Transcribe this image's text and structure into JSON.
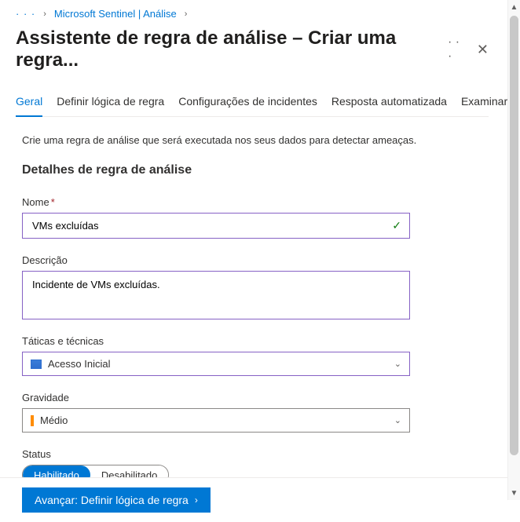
{
  "breadcrumb": {
    "dots": "· · ·",
    "item1": "Microsoft Sentinel | Análise"
  },
  "header": {
    "title": "Assistente de regra de análise – Criar uma regra...",
    "more": "· · ·"
  },
  "tabs": [
    {
      "label": "Geral",
      "active": true
    },
    {
      "label": "Definir lógica de regra",
      "active": false
    },
    {
      "label": "Configurações de incidentes",
      "active": false
    },
    {
      "label": "Resposta automatizada",
      "active": false
    },
    {
      "label": "Examinar e criar",
      "active": false
    }
  ],
  "intro": "Crie uma regra de análise que será executada nos seus dados para detectar ameaças.",
  "section_title": "Detalhes de regra de análise",
  "fields": {
    "name": {
      "label": "Nome",
      "required": "*",
      "value": "VMs excluídas"
    },
    "description": {
      "label": "Descrição",
      "value": "Incidente de VMs excluídas."
    },
    "tactics": {
      "label": "Táticas e técnicas",
      "value": "Acesso Inicial"
    },
    "severity": {
      "label": "Gravidade",
      "value": "Médio"
    },
    "status": {
      "label": "Status",
      "enabled": "Habilitado",
      "disabled": "Desabilitado"
    }
  },
  "footer": {
    "next": "Avançar: Definir lógica de regra"
  }
}
